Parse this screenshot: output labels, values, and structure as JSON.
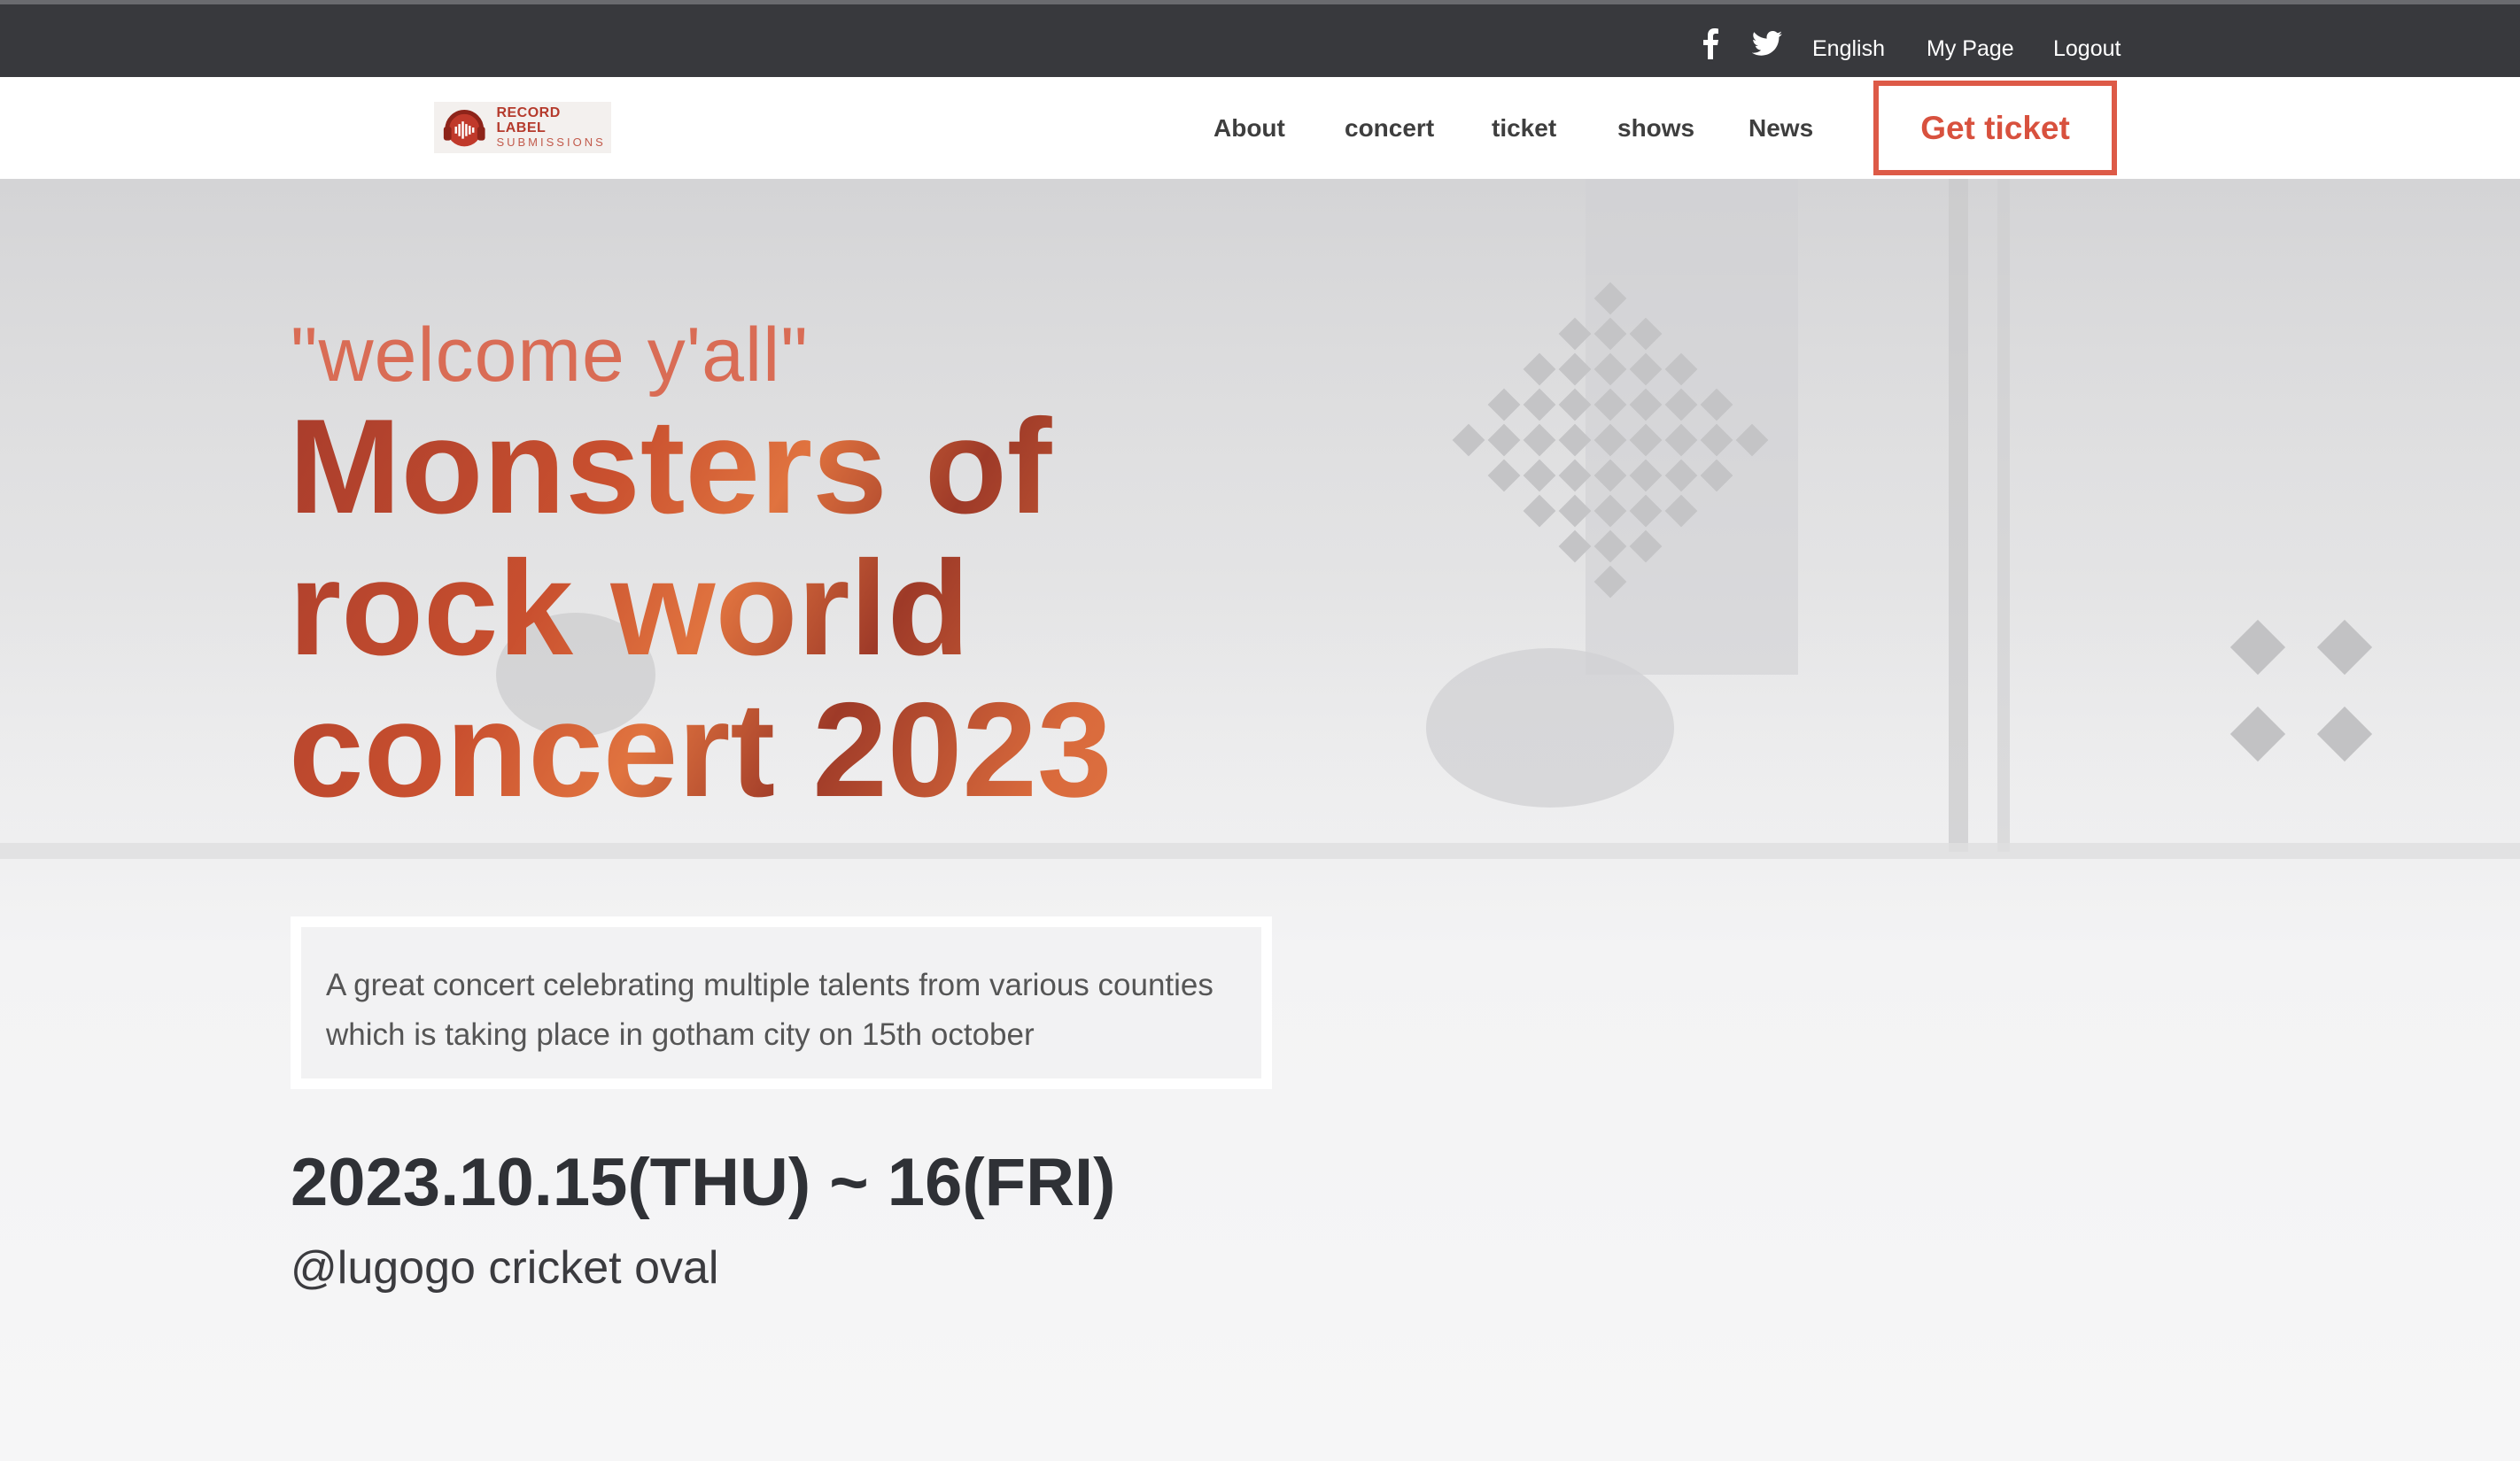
{
  "topbar": {
    "facebook_icon": "facebook-icon",
    "twitter_icon": "twitter-icon",
    "language": "English",
    "my_page": "My Page",
    "logout": "Logout"
  },
  "nav": {
    "logo_line1": "RECORD LABEL",
    "logo_line2": "SUBMISSIONS",
    "items": [
      {
        "label": "About"
      },
      {
        "label": "concert"
      },
      {
        "label": "ticket"
      },
      {
        "label": "shows"
      },
      {
        "label": "News"
      }
    ],
    "cta": "Get ticket"
  },
  "hero": {
    "welcome": "\"welcome y'all\"",
    "headline_line1": "Monsters of",
    "headline_line2": "rock world",
    "headline_line3": "concert 2023",
    "description_line1": "A great concert celebrating multiple talents from various counties",
    "description_line2": "which is taking place in gotham city on 15th october",
    "dates": "2023.10.15(THU) ~ 16(FRI)",
    "venue": "@lugogo cricket oval"
  },
  "colors": {
    "accent": "#dd5a47",
    "topbar_bg": "#38393d",
    "headline_dark": "#a83c2c",
    "headline_light": "#e47a45"
  }
}
